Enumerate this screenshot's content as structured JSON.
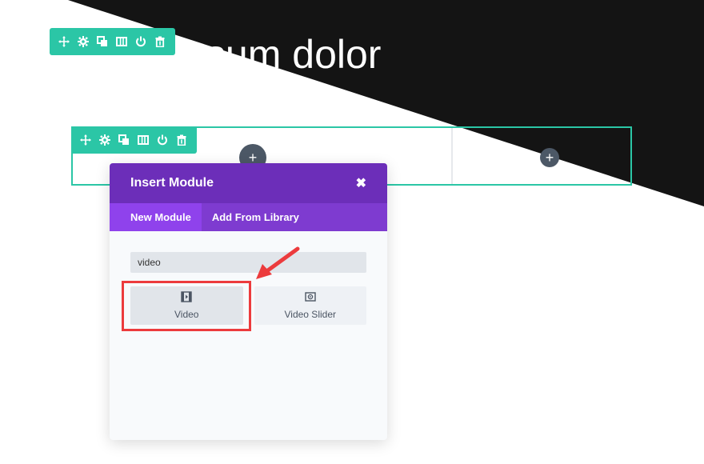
{
  "hero": {
    "text": "ipsum dolor"
  },
  "colors": {
    "accent": "#2bc6a6",
    "modal_header": "#6c2eb9",
    "modal_tabs": "#7e3bd0",
    "highlight": "#ec3b3d",
    "dark_bg": "#141414"
  },
  "section_toolbar": {
    "icons": [
      "move-icon",
      "settings-icon",
      "duplicate-icon",
      "columns-icon",
      "power-icon",
      "trash-icon"
    ]
  },
  "row_toolbar": {
    "icons": [
      "move-icon",
      "settings-icon",
      "duplicate-icon",
      "columns-icon",
      "power-icon",
      "trash-icon"
    ]
  },
  "modal": {
    "title": "Insert Module",
    "tabs": [
      "New Module",
      "Add From Library"
    ],
    "search": {
      "value": "video"
    },
    "modules": [
      {
        "label": "Video",
        "icon": "video-icon",
        "selected": true
      },
      {
        "label": "Video Slider",
        "icon": "video-slider-icon",
        "selected": false
      }
    ]
  },
  "add_buttons": {
    "symbol": "+"
  }
}
